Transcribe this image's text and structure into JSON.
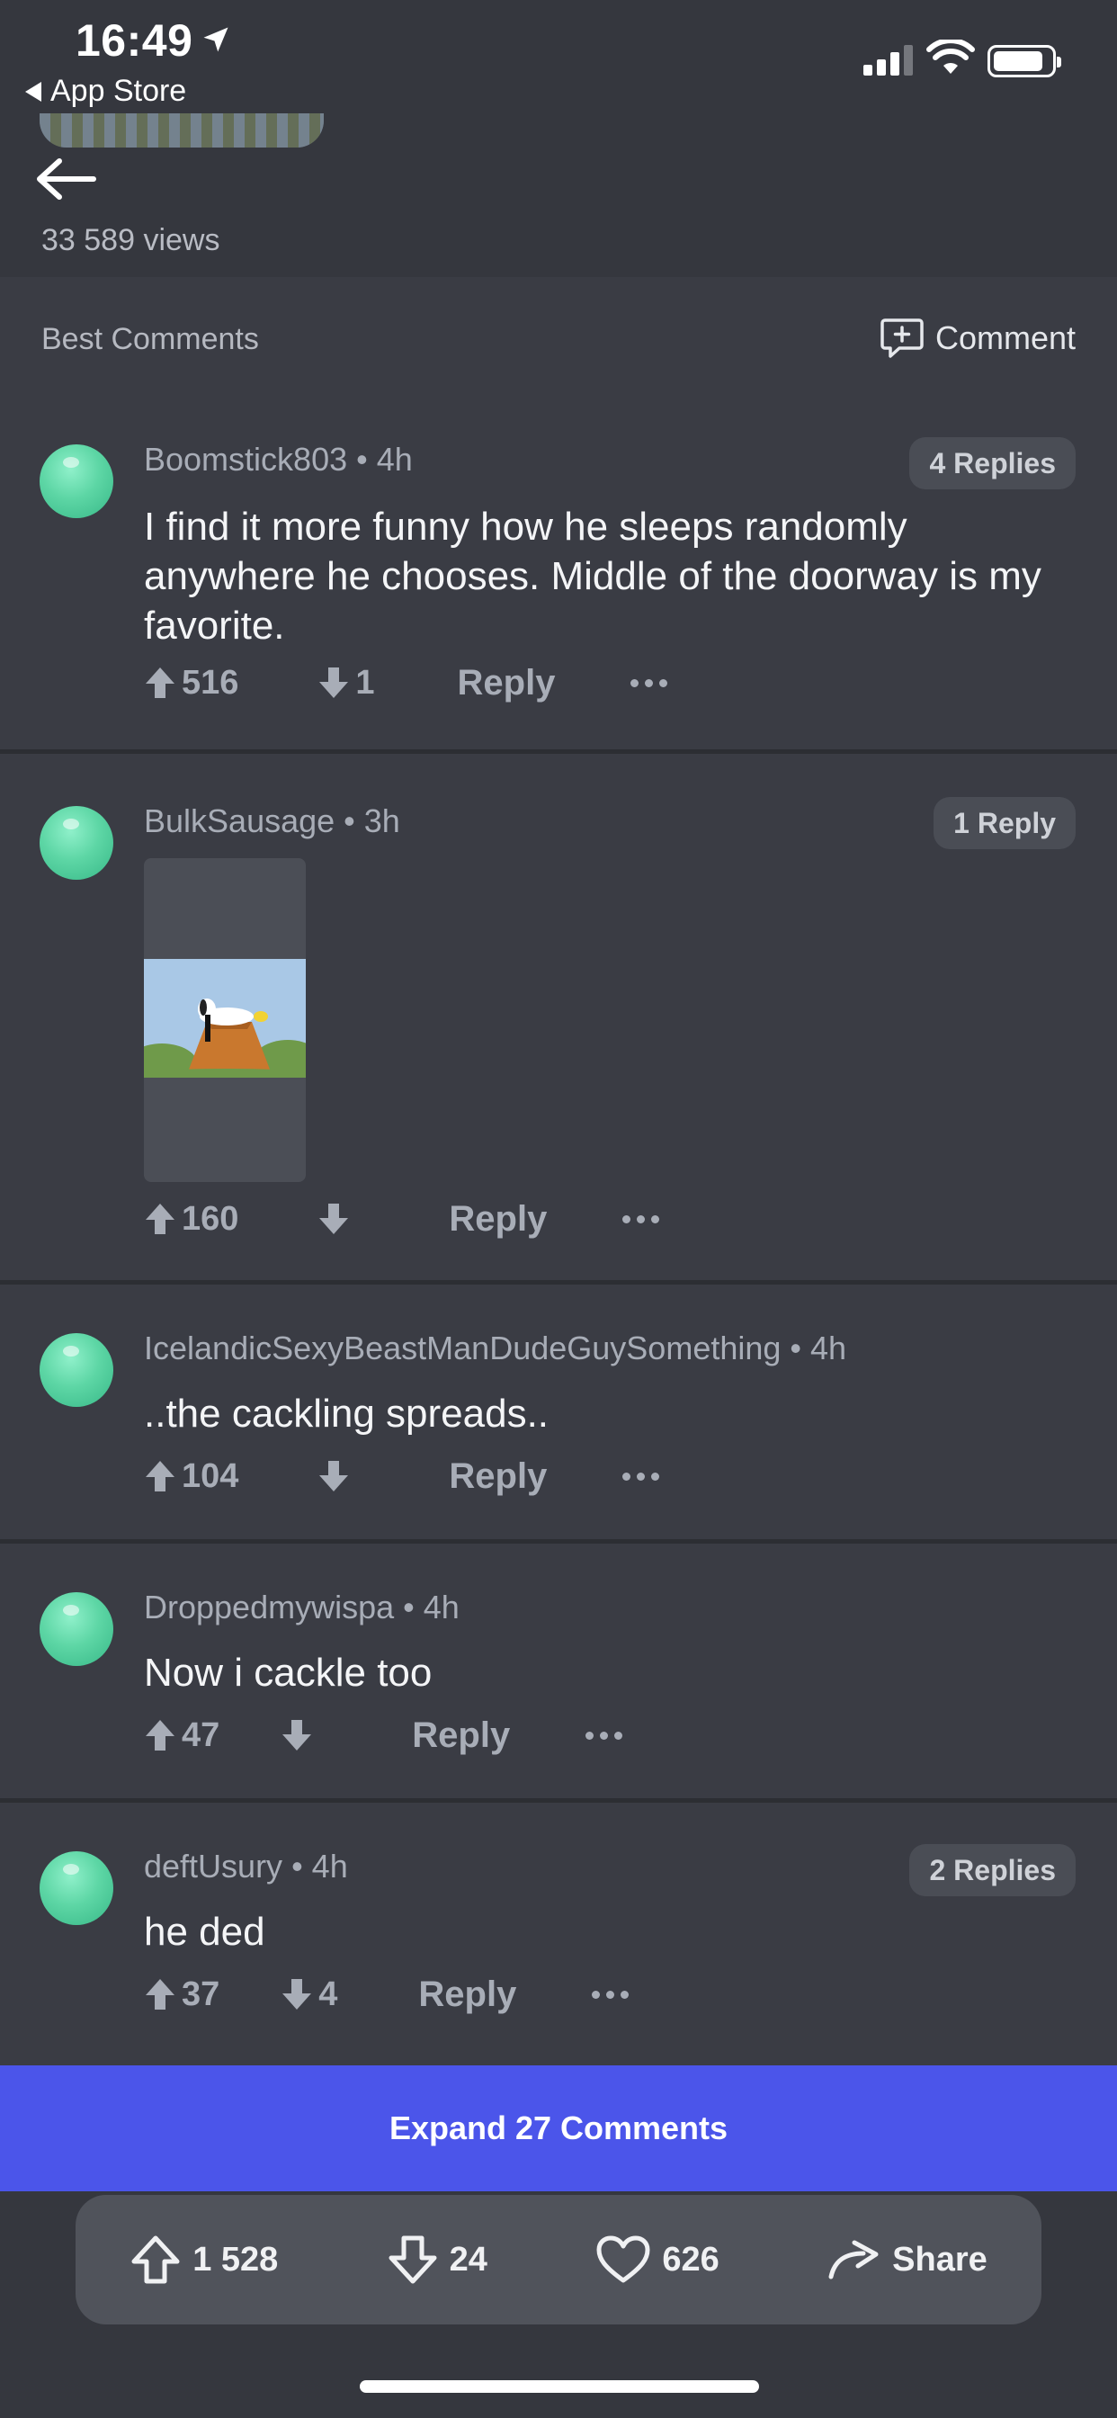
{
  "status_bar": {
    "time": "16:49",
    "back_app": "App Store"
  },
  "header": {
    "views": "33 589 views"
  },
  "comments_header": {
    "title": "Best Comments",
    "comment_label": "Comment"
  },
  "comments": [
    {
      "user": "Boomstick803",
      "age": "4h",
      "replies": "4 Replies",
      "text": "I find it more funny how he sleeps randomly anywhere he chooses. Middle of the doorway is my favorite.",
      "up": "516",
      "down": "1",
      "reply": "Reply"
    },
    {
      "user": "BulkSausage",
      "age": "3h",
      "replies": "1 Reply",
      "text": "",
      "up": "160",
      "down": "",
      "reply": "Reply"
    },
    {
      "user": "IcelandicSexyBeastManDudeGuySomething",
      "age": "4h",
      "replies": "",
      "text": "..the cackling spreads..",
      "up": "104",
      "down": "",
      "reply": "Reply"
    },
    {
      "user": "Droppedmywispa",
      "age": "4h",
      "replies": "",
      "text": "Now i cackle too",
      "up": "47",
      "down": "",
      "reply": "Reply"
    },
    {
      "user": "deftUsury",
      "age": "4h",
      "replies": "2 Replies",
      "text": "he ded",
      "up": "37",
      "down": "4",
      "reply": "Reply"
    }
  ],
  "expand": {
    "label": "Expand 27 Comments"
  },
  "bottom_bar": {
    "upvotes": "1 528",
    "downvotes": "24",
    "favorites": "626",
    "share": "Share"
  },
  "colors": {
    "accent": "#4b55ea",
    "background": "#3a3c44",
    "avatar": "#5dd6a5"
  }
}
